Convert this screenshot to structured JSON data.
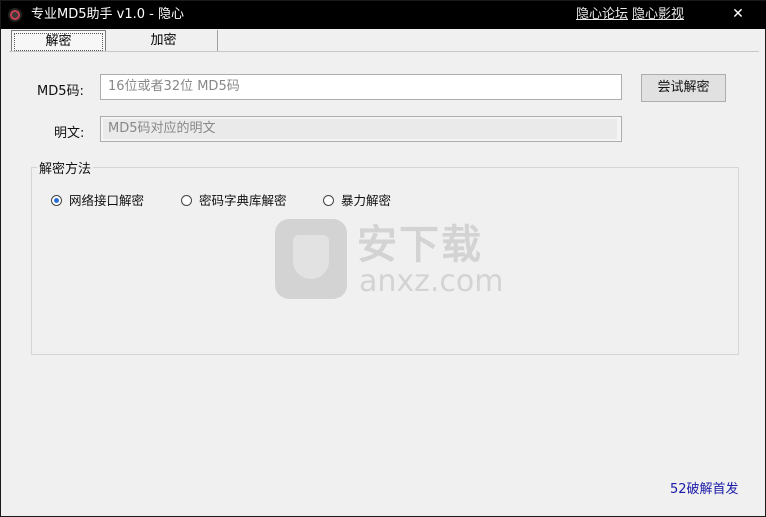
{
  "window": {
    "title": "专业MD5助手 v1.0 - 隐心",
    "links": [
      "隐心论坛",
      "隐心影视"
    ],
    "close_glyph": "✕"
  },
  "tabs": [
    {
      "label": "解密",
      "active": true
    },
    {
      "label": "加密",
      "active": false
    }
  ],
  "form": {
    "md5_label": "MD5码:",
    "md5_placeholder": "16位或者32位 MD5码",
    "md5_value": "",
    "plain_label": "明文:",
    "plain_placeholder": "MD5码对应的明文",
    "decrypt_button": "尝试解密"
  },
  "method_group": {
    "title": "解密方法",
    "options": [
      {
        "label": "网络接口解密",
        "selected": true
      },
      {
        "label": "密码字典库解密",
        "selected": false
      },
      {
        "label": "暴力解密",
        "selected": false
      }
    ]
  },
  "watermark": {
    "cn": "安下载",
    "en": "anxz.com"
  },
  "footer": {
    "link": "52破解首发"
  },
  "colors": {
    "titlebar": "#000000",
    "accent_radio": "#2b6fd6",
    "footer_link": "#1a1aa8"
  },
  "icons": {
    "app": "app-logo-icon",
    "close": "close-icon",
    "watermark": "shield-bag-logo"
  }
}
